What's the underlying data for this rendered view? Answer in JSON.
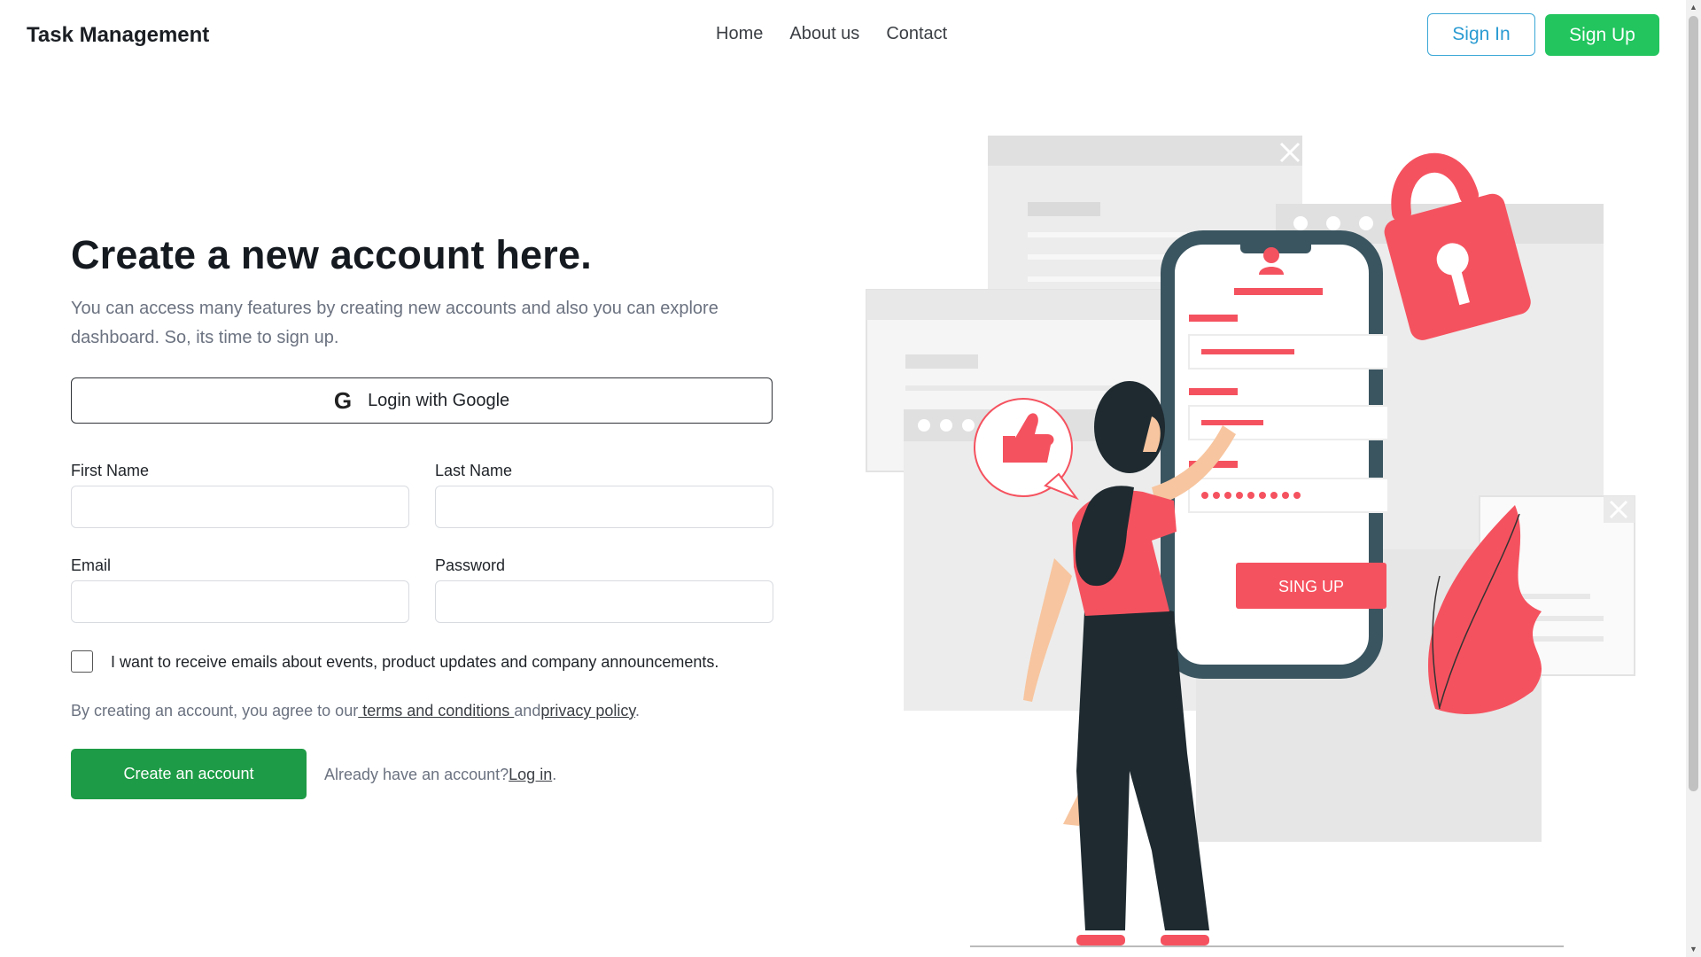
{
  "navbar": {
    "brand": "Task Management",
    "links": [
      "Home",
      "About us",
      "Contact"
    ],
    "signin_label": "Sign In",
    "signup_label": "Sign Up"
  },
  "form": {
    "heading": "Create a new account here.",
    "subtext": "You can access many features by creating new accounts and also you can explore dashboard. So, its time to sign up.",
    "google_label": "Login with Google",
    "fields": {
      "first_name": {
        "label": "First Name",
        "value": "",
        "placeholder": ""
      },
      "last_name": {
        "label": "Last Name",
        "value": "",
        "placeholder": ""
      },
      "email": {
        "label": "Email",
        "value": "",
        "placeholder": ""
      },
      "password": {
        "label": "Password",
        "value": "",
        "placeholder": ""
      }
    },
    "checkbox_label": "I want to receive emails about events, product updates and company announcements.",
    "terms_prefix": "By creating an account, you agree to our",
    "terms_link": " terms and conditions ",
    "terms_and": "and",
    "privacy_link": "privacy policy",
    "terms_end": ".",
    "create_label": "Create an account",
    "login_prefix": "Already have an account?",
    "login_link": "Log in",
    "login_end": "."
  },
  "illustration": {
    "button_label": "SING UP"
  },
  "colors": {
    "accent_green": "#22c55e",
    "create_green": "#1e9b46",
    "signin_blue": "#2a9bd2",
    "illustration_red": "#f5525f",
    "phone_frame": "#3a5560"
  }
}
